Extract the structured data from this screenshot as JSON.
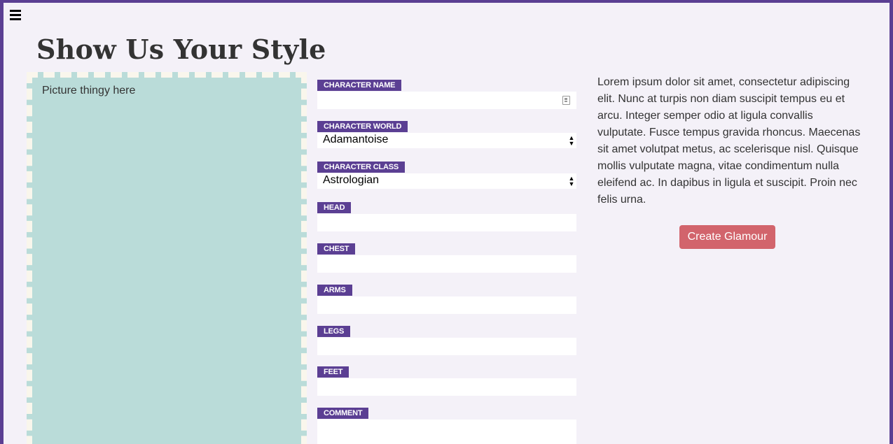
{
  "header": {
    "menu_icon": "hamburger-menu-icon",
    "title": "Show Us Your Style"
  },
  "picture": {
    "label": "Picture thingy here"
  },
  "form": {
    "character_name": {
      "label": "CHARACTER NAME",
      "value": ""
    },
    "character_world": {
      "label": "CHARACTER WORLD",
      "selected": "Adamantoise"
    },
    "character_class": {
      "label": "CHARACTER CLASS",
      "selected": "Astrologian"
    },
    "head": {
      "label": "HEAD",
      "value": ""
    },
    "chest": {
      "label": "CHEST",
      "value": ""
    },
    "arms": {
      "label": "ARMS",
      "value": ""
    },
    "legs": {
      "label": "LEGS",
      "value": ""
    },
    "feet": {
      "label": "FEET",
      "value": ""
    },
    "comment": {
      "label": "COMMENT",
      "value": ""
    }
  },
  "description": "Lorem ipsum dolor sit amet, consectetur adipiscing elit. Nunc at turpis non diam suscipit tempus eu et arcu. Integer semper odio at ligula convallis vulputate. Fusce tempus gravida rhoncus. Maecenas sit amet volutpat metus, ac scelerisque nisl. Quisque mollis vulputate magna, vitae condimentum nulla eleifend ac. In dapibus in ligula et suscipit. Proin nec felis urna.",
  "actions": {
    "create_label": "Create Glamour"
  },
  "colors": {
    "frame": "#5b3f93",
    "background": "#f4f1f8",
    "picture_fill": "#badcd9",
    "picture_dash": "#f9f6ec",
    "button": "#d2646c"
  }
}
